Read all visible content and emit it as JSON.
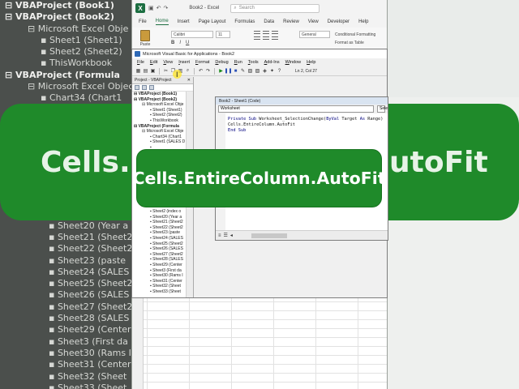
{
  "background": {
    "left_tree": [
      {
        "text": "VBAProject (Book1)",
        "level": 0,
        "bold": true
      },
      {
        "text": "VBAProject (Book2)",
        "level": 0,
        "bold": true
      },
      {
        "text": "Microsoft Excel Obje",
        "level": 1
      },
      {
        "text": "Sheet1 (Sheet1)",
        "level": 2
      },
      {
        "text": "Sheet2 (Sheet2)",
        "level": 2
      },
      {
        "text": "ThisWorkbook",
        "level": 2
      },
      {
        "text": "VBAProject (Formula",
        "level": 0,
        "bold": true
      },
      {
        "text": "Microsoft Excel Object",
        "level": 1
      },
      {
        "text": "Chart34 (Chart1",
        "level": 2
      },
      {
        "text": "Sheet1 (SALES D",
        "level": 2
      },
      {
        "text": "",
        "level": 2
      },
      {
        "text": "",
        "level": 2
      },
      {
        "text": "",
        "level": 2
      },
      {
        "text": "",
        "level": 2
      },
      {
        "text": "",
        "level": 2
      },
      {
        "text": "",
        "level": 2
      },
      {
        "text": "",
        "level": 2
      },
      {
        "text": "",
        "level": 2
      },
      {
        "text": "Sheet2 (index o",
        "level": 3
      },
      {
        "text": "Sheet20 (Year a",
        "level": 3
      },
      {
        "text": "Sheet21 (Sheet2",
        "level": 3
      },
      {
        "text": "Sheet22 (Sheet2",
        "level": 3
      },
      {
        "text": "Sheet23 (paste",
        "level": 3
      },
      {
        "text": "Sheet24 (SALES",
        "level": 3
      },
      {
        "text": "Sheet25 (Sheet2",
        "level": 3
      },
      {
        "text": "Sheet26 (SALES",
        "level": 3
      },
      {
        "text": "Sheet27 (Sheet2",
        "level": 3
      },
      {
        "text": "Sheet28 (SALES",
        "level": 3
      },
      {
        "text": "Sheet29 (Center",
        "level": 3
      },
      {
        "text": "Sheet3 (First da",
        "level": 3
      },
      {
        "text": "Sheet30 (Rams I",
        "level": 3
      },
      {
        "text": "Sheet31 (Center",
        "level": 3
      },
      {
        "text": "Sheet32 (Sheet",
        "level": 3
      },
      {
        "text": "Sheet33 (Sheet",
        "level": 3
      }
    ],
    "banner_left": "Cells.E",
    "banner_right": "utoFit"
  },
  "excel": {
    "doc_name": "Book2 - Excel",
    "search_placeholder": "Search",
    "tabs": [
      "File",
      "Home",
      "Insert",
      "Page Layout",
      "Formulas",
      "Data",
      "Review",
      "View",
      "Developer",
      "Help"
    ],
    "active_tab": "Home",
    "paste_label": "Paste",
    "font_name": "Calibri",
    "font_size": "11",
    "bold": "B",
    "italic": "I",
    "underline": "U",
    "number_format": "General",
    "conditional_formatting": "Conditional Formatting",
    "format_as_table": "Format as Table",
    "accent": "#1d6f42"
  },
  "vbe": {
    "title": "Microsoft Visual Basic for Applications - Book2",
    "menu": [
      "File",
      "Edit",
      "View",
      "Insert",
      "Format",
      "Debug",
      "Run",
      "Tools",
      "Add-Ins",
      "Window",
      "Help"
    ],
    "position": "Ln 2, Col 27",
    "project_title": "Project - VBAProject",
    "close_glyph": "✕",
    "project_tree": [
      {
        "text": "VBAProject (Book1)",
        "level": 0,
        "bold": true
      },
      {
        "text": "VBAProject (Book2)",
        "level": 0,
        "bold": true
      },
      {
        "text": "Microsoft Excel Obje",
        "level": 1
      },
      {
        "text": "Sheet1 (Sheet1)",
        "level": 2
      },
      {
        "text": "Sheet2 (Sheet2)",
        "level": 2
      },
      {
        "text": "ThisWorkbook",
        "level": 2
      },
      {
        "text": "VBAProject (Formula",
        "level": 0,
        "bold": true
      },
      {
        "text": "Microsoft Excel Obje",
        "level": 1
      },
      {
        "text": "Chart34 (Chart1",
        "level": 2
      },
      {
        "text": "Sheet1 (SALES D",
        "level": 2
      },
      {
        "text": "",
        "level": 2
      },
      {
        "text": "",
        "level": 2
      },
      {
        "text": "",
        "level": 2
      },
      {
        "text": "",
        "level": 2
      },
      {
        "text": "",
        "level": 2
      },
      {
        "text": "",
        "level": 2
      },
      {
        "text": "",
        "level": 2
      },
      {
        "text": "",
        "level": 2
      },
      {
        "text": "",
        "level": 2
      },
      {
        "text": "",
        "level": 2
      },
      {
        "text": "",
        "level": 2
      },
      {
        "text": "",
        "level": 2
      },
      {
        "text": "Sheet2 (index o",
        "level": 2
      },
      {
        "text": "Sheet20 (Year a",
        "level": 2
      },
      {
        "text": "Sheet21 (Sheet2",
        "level": 2
      },
      {
        "text": "Sheet22 (Sheet2",
        "level": 2
      },
      {
        "text": "Sheet23 (paste",
        "level": 2
      },
      {
        "text": "Sheet24 (SALES",
        "level": 2
      },
      {
        "text": "Sheet25 (Sheet2",
        "level": 2
      },
      {
        "text": "Sheet26 (SALES",
        "level": 2
      },
      {
        "text": "Sheet27 (Sheet2",
        "level": 2
      },
      {
        "text": "Sheet28 (SALES",
        "level": 2
      },
      {
        "text": "Sheet29 (Center",
        "level": 2
      },
      {
        "text": "Sheet3 (First da",
        "level": 2
      },
      {
        "text": "Sheet30 (Rams I",
        "level": 2
      },
      {
        "text": "Sheet31 (Center",
        "level": 2
      },
      {
        "text": "Sheet32 (Sheet",
        "level": 2
      },
      {
        "text": "Sheet33 (Sheet",
        "level": 2
      }
    ],
    "code_window_title": "Book2 - Sheet1 (Code)",
    "object_combo": "Worksheet",
    "proc_combo": "Sele",
    "code_lines": [
      "Private Sub Worksheet_SelectionChange(ByVal Target As Range)",
      "Cells.EntireColumn.AutoFit",
      "End Sub"
    ]
  },
  "caption": "Cells.EntireColumn.AutoFit",
  "colors": {
    "caption_bg": "#1f8a2a",
    "caption_text": "#ffffff"
  }
}
